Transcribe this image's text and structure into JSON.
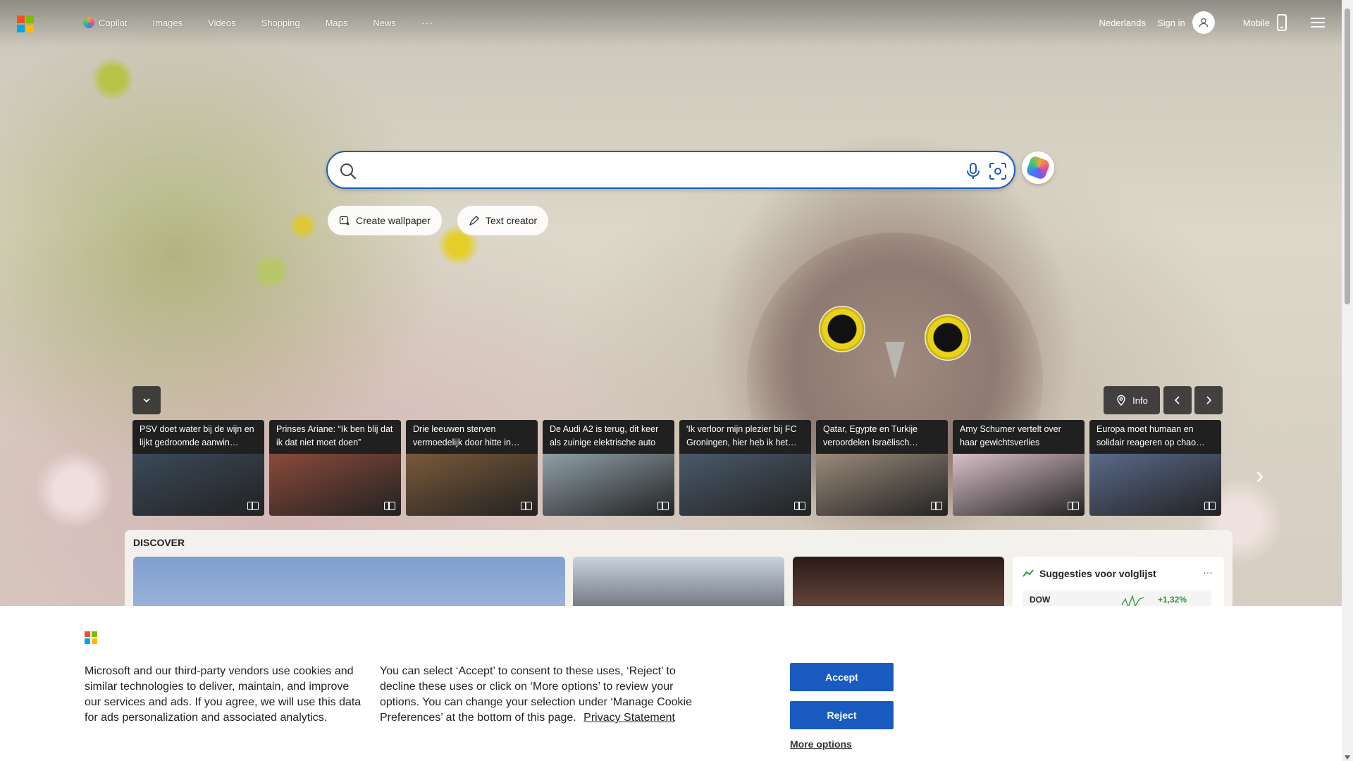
{
  "topbar": {
    "nav": [
      "Copilot",
      "Images",
      "Videos",
      "Shopping",
      "Maps",
      "News"
    ],
    "more": "···",
    "language": "Nederlands",
    "signin": "Sign in",
    "mobile": "Mobile"
  },
  "search": {
    "value": "",
    "placeholder": ""
  },
  "actions": {
    "create_wallpaper": "Create wallpaper",
    "text_creator": "Text creator"
  },
  "strip": {
    "info": "Info"
  },
  "news": [
    {
      "title": "PSV doet water bij de wijn en lijkt gedroomde aanwin…",
      "color": "#3b4a5a"
    },
    {
      "title": "Prinses Ariane: “Ik ben blij dat ik dat niet moet doen”",
      "color": "#8a4a3a"
    },
    {
      "title": "Drie leeuwen sterven vermoedelijk door hitte in…",
      "color": "#7a5a3a"
    },
    {
      "title": "De Audi A2 is terug, dit keer als zuinige elektrische auto",
      "color": "#8fa0a8"
    },
    {
      "title": "'Ik verloor mijn plezier bij FC Groningen, hier heb ik het…",
      "color": "#4a5a6a"
    },
    {
      "title": "Qatar, Egypte en Turkije veroordelen Israëlisch…",
      "color": "#9a8a7a"
    },
    {
      "title": "Amy Schumer vertelt over haar gewichtsverlies",
      "color": "#d9c0c8"
    },
    {
      "title": "Europa moet humaan en solidair reageren op chao…",
      "color": "#5a6a8a"
    }
  ],
  "discover": {
    "heading": "DISCOVER",
    "watchlist_title": "Suggesties voor volglijst",
    "ticker": "DOW",
    "change": "+1,32%"
  },
  "cookie": {
    "text_left": "Microsoft and our third-party vendors use cookies and similar technologies to deliver, maintain, and improve our services and ads. If you agree, we will use this data for ads personalization and associated analytics.",
    "text_right": "You can select ‘Accept’ to consent to these uses, ‘Reject’ to decline these uses or click on ‘More options’ to review your options. You can change your selection under ‘Manage Cookie Preferences’ at the bottom of this page.",
    "privacy_link": "Privacy Statement",
    "accept": "Accept",
    "reject": "Reject",
    "more": "More options"
  }
}
